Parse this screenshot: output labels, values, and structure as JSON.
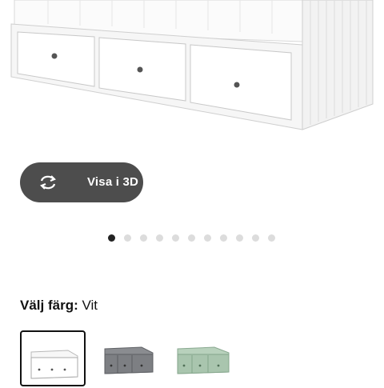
{
  "product_image": {
    "alt": "",
    "view3d": {
      "label": "Visa i 3D",
      "icon": "rotate-3d-icon"
    },
    "carousel": {
      "count": 11,
      "active_index": 0
    }
  },
  "color_picker": {
    "label": "Välj färg:",
    "selected_value": "Vit",
    "options": [
      {
        "name": "Vit",
        "color": "#ffffff",
        "selected": true
      },
      {
        "name": "Grå",
        "color": "#7d7f83",
        "selected": false
      },
      {
        "name": "Grön",
        "color": "#a9c5ae",
        "selected": false
      }
    ]
  },
  "colors": {
    "button_bg": "#4d4d4d",
    "dot_active": "#222222",
    "dot_inactive": "#dcdcdc"
  }
}
